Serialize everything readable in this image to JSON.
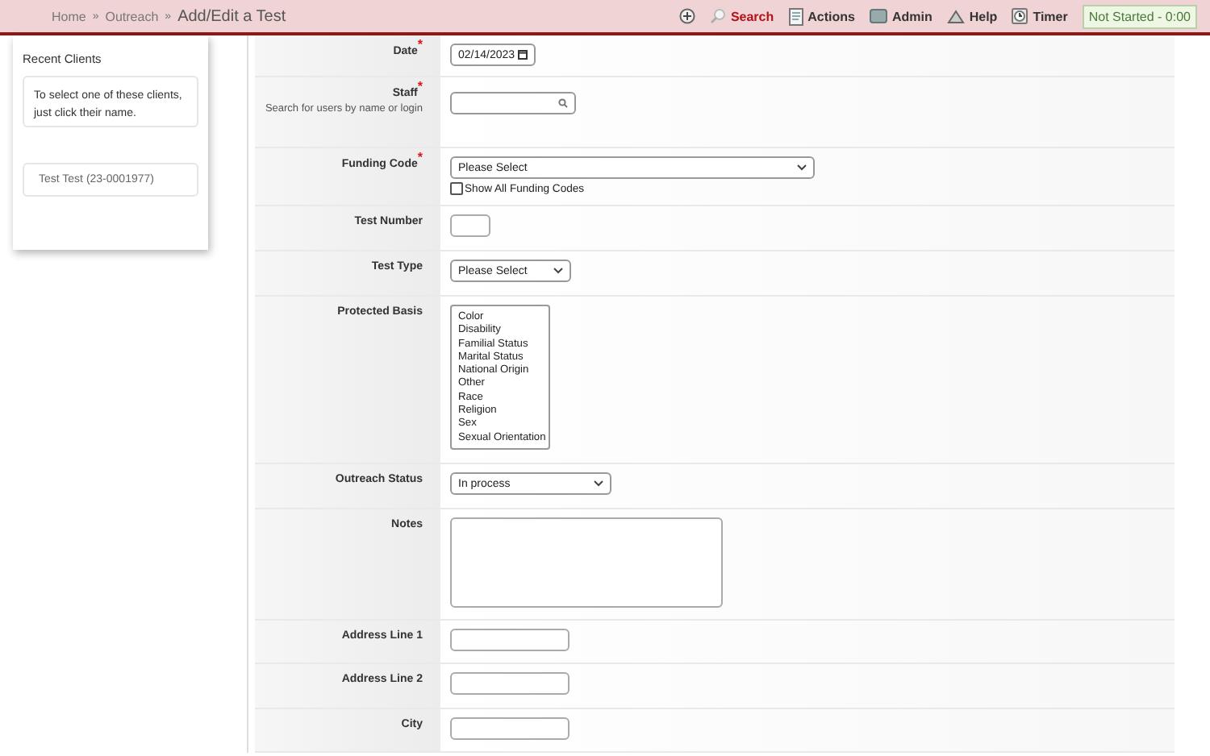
{
  "breadcrumb": {
    "links": [
      "Home",
      "Outreach"
    ],
    "separator": "»",
    "current": "Add/Edit a Test"
  },
  "toolbar": {
    "items": [
      {
        "kind": "add"
      },
      {
        "kind": "search",
        "label": "Search",
        "highlighted": true
      },
      {
        "kind": "actions",
        "label": "Actions",
        "highlighted": false
      },
      {
        "kind": "admin",
        "label": "Admin",
        "highlighted": false
      },
      {
        "kind": "help",
        "label": "Help",
        "highlighted": false
      },
      {
        "kind": "timer",
        "label": "Timer",
        "highlighted": false
      }
    ],
    "timer_status": "Not Started - 0:00"
  },
  "sidebar": {
    "title": "Recent Clients",
    "hint": "To select one of these clients, just click their name.",
    "clients": [
      "Test Test (23-0001977)"
    ]
  },
  "form": {
    "rows": [
      {
        "label": "Date",
        "required_mark": "*",
        "kind": "date",
        "value": "02/14/2023"
      },
      {
        "label": "Staff",
        "required_mark": "*",
        "help": "Search for users by name or login",
        "kind": "search"
      },
      {
        "label": "Funding Code",
        "required_mark": "*",
        "kind": "select",
        "value": "Please Select",
        "checkbox": {
          "label": "Show All Funding Codes",
          "checked": false
        }
      },
      {
        "label": "Test Number",
        "kind": "text"
      },
      {
        "label": "Test Type",
        "kind": "select",
        "value": "Please Select"
      },
      {
        "label": "Protected Basis",
        "kind": "listbox",
        "options": [
          "Color",
          "Disability",
          "Familial Status",
          "Marital Status",
          "National Origin",
          "Other",
          "Race",
          "Religion",
          "Sex",
          "Sexual Orientation"
        ]
      },
      {
        "label": "Outreach Status",
        "kind": "select",
        "value": "In process"
      },
      {
        "label": "Notes",
        "kind": "textarea"
      },
      {
        "label": "Address Line 1",
        "kind": "text"
      },
      {
        "label": "Address Line 2",
        "kind": "text"
      },
      {
        "label": "City",
        "kind": "text"
      }
    ]
  }
}
